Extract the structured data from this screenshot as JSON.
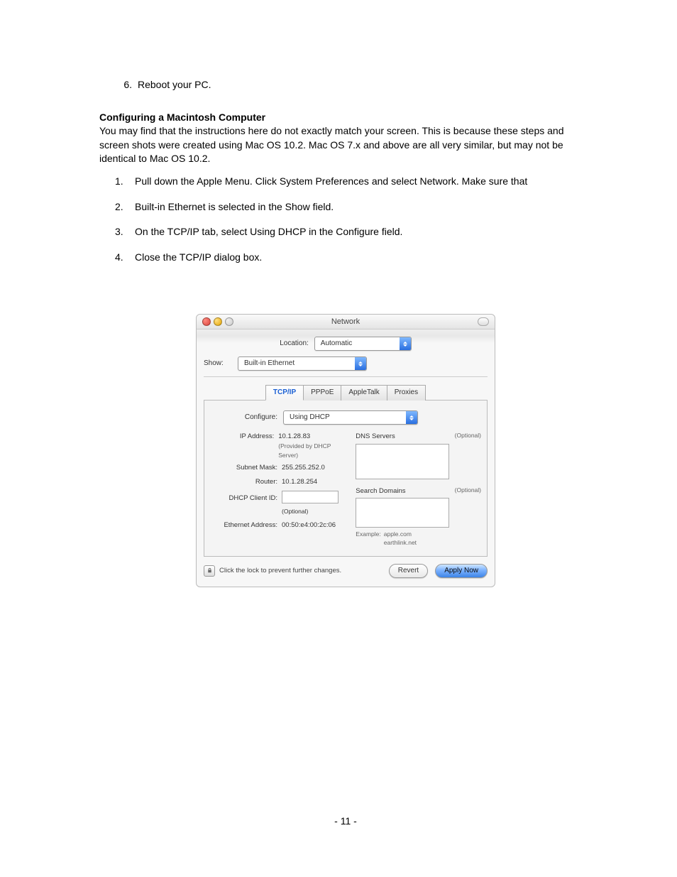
{
  "doc": {
    "step6_num": "6.",
    "step6_text": "Reboot your PC.",
    "heading": "Configuring a Macintosh Computer",
    "intro": "You may find that the instructions here do not exactly match your screen. This is because these steps and screen shots were created using Mac OS 10.2. Mac OS 7.x and above are all very similar, but may not be identical to Mac OS 10.2.",
    "steps": [
      "Pull down the Apple Menu. Click System Preferences and select Network. Make sure that",
      "Built-in Ethernet is selected in the Show field.",
      "On the TCP/IP tab, select Using DHCP in the Configure field.",
      "Close the TCP/IP dialog box."
    ],
    "page_number": "- 11 -"
  },
  "win": {
    "title": "Network",
    "location_label": "Location:",
    "location_value": "Automatic",
    "show_label": "Show:",
    "show_value": "Built-in Ethernet",
    "tabs": [
      "TCP/IP",
      "PPPoE",
      "AppleTalk",
      "Proxies"
    ],
    "configure_label": "Configure:",
    "configure_value": "Using DHCP",
    "ip_label": "IP Address:",
    "ip_value": "10.1.28.83",
    "ip_note": "(Provided by DHCP Server)",
    "mask_label": "Subnet Mask:",
    "mask_value": "255.255.252.0",
    "router_label": "Router:",
    "router_value": "10.1.28.254",
    "dhcp_label": "DHCP Client ID:",
    "dhcp_note": "(Optional)",
    "mac_label": "Ethernet Address:",
    "mac_value": "00:50:e4:00:2c:06",
    "dns_label": "DNS Servers",
    "dns_opt": "(Optional)",
    "search_label": "Search Domains",
    "search_opt": "(Optional)",
    "example_label": "Example:",
    "example_value1": "apple.com",
    "example_value2": "earthlink.net",
    "lock_text": "Click the lock to prevent further changes.",
    "revert": "Revert",
    "apply": "Apply Now"
  }
}
